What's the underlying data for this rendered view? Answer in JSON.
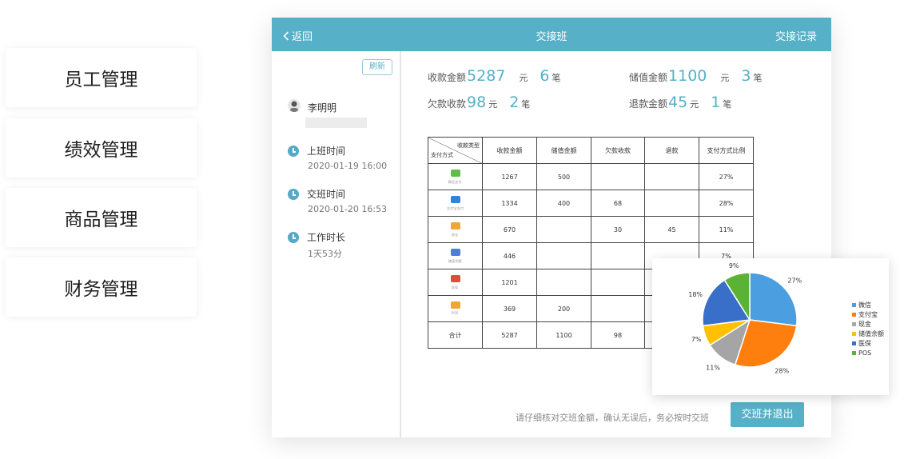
{
  "menu": [
    "员工管理",
    "绩效管理",
    "商品管理",
    "财务管理"
  ],
  "topbar": {
    "back": "返回",
    "title": "交接班",
    "records": "交接记录"
  },
  "sidebar": {
    "refresh": "刷新",
    "user_name": "李明明",
    "start_label": "上班时间",
    "start_value": "2020-01-19 16:00",
    "handover_label": "交班时间",
    "handover_value": "2020-01-20 16:53",
    "duration_label": "工作时长",
    "duration_value": "1天53分"
  },
  "stats": {
    "collect": {
      "label": "收款金额",
      "amount": "5287",
      "unit": "元",
      "count": "6",
      "count_unit": "笔"
    },
    "stored": {
      "label": "储值金额",
      "amount": "1100",
      "unit": "元",
      "count": "3",
      "count_unit": "笔"
    },
    "arrears": {
      "label": "欠款收款",
      "amount": "98",
      "unit": "元",
      "count": "2",
      "count_unit": "笔"
    },
    "refund": {
      "label": "退款金额",
      "amount": "45",
      "unit": "元",
      "count": "1",
      "count_unit": "笔"
    }
  },
  "table": {
    "corner_top": "收款类型",
    "corner_bottom": "支付方式",
    "headers": [
      "收款金额",
      "储值金额",
      "欠款收款",
      "退款",
      "支付方式比例"
    ],
    "rows": [
      {
        "method": "微信支付",
        "icon_color": "#5bbf4a",
        "cells": [
          "1267",
          "500",
          "",
          "",
          "27%"
        ]
      },
      {
        "method": "支付宝支付",
        "icon_color": "#2f86d8",
        "cells": [
          "1334",
          "400",
          "68",
          "",
          "28%"
        ]
      },
      {
        "method": "现金",
        "icon_color": "#f2a532",
        "cells": [
          "670",
          "",
          "30",
          "45",
          "11%"
        ]
      },
      {
        "method": "储值余额",
        "icon_color": "#4c7fd6",
        "cells": [
          "446",
          "",
          "",
          "",
          "7%"
        ]
      },
      {
        "method": "医保",
        "icon_color": "#e04b3a",
        "cells": [
          "1201",
          "",
          "",
          "",
          ""
        ]
      },
      {
        "method": "POS",
        "icon_color": "#f2a532",
        "cells": [
          "369",
          "200",
          "",
          "",
          ""
        ]
      }
    ],
    "total": {
      "label": "合计",
      "cells": [
        "5287",
        "1100",
        "98",
        "",
        ""
      ]
    }
  },
  "note": "请仔细核对交班金额，确认无误后，务必按时交班",
  "submit": "交班并退出",
  "chart_data": {
    "type": "pie",
    "slices": [
      {
        "name": "微信",
        "value": 27,
        "label": "27%",
        "color": "#4b9fe0"
      },
      {
        "name": "支付宝",
        "value": 28,
        "label": "28%",
        "color": "#ff7f0e"
      },
      {
        "name": "现金",
        "value": 11,
        "label": "11%",
        "color": "#a5a5a5"
      },
      {
        "name": "储值余额",
        "value": 7,
        "label": "7%",
        "color": "#ffc000"
      },
      {
        "name": "医保",
        "value": 18,
        "label": "18%",
        "color": "#3a6fc9"
      },
      {
        "name": "POS",
        "value": 9,
        "label": "9%",
        "color": "#5cb234"
      }
    ]
  }
}
